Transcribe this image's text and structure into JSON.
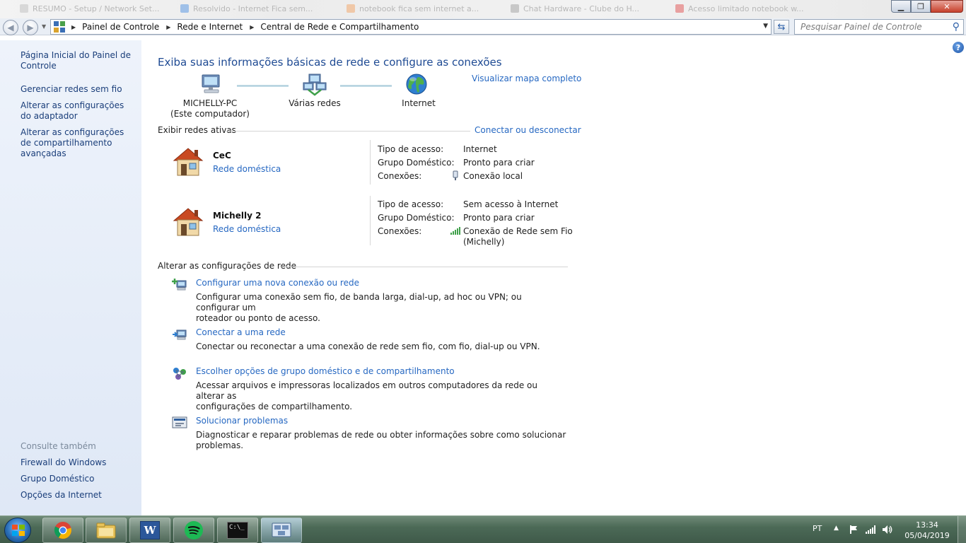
{
  "background_tabs": [
    "RESUMO - Setup / Network Set...",
    "Resolvido - Internet Fica sem...",
    "notebook fica sem internet a...",
    "Chat Hardware - Clube do H...",
    "Acesso limitado notebook w..."
  ],
  "window": {
    "minimize_label": "▁",
    "maximize_label": "❐",
    "close_label": "✕"
  },
  "address": {
    "back_icon": "back-arrow-icon",
    "forward_icon": "forward-arrow-icon",
    "breadcrumbs": [
      "Painel de Controle",
      "Rede e Internet",
      "Central de Rede e Compartilhamento"
    ],
    "search_placeholder": "Pesquisar Painel de Controle"
  },
  "sidebar": {
    "links": [
      "Página Inicial do Painel de Controle",
      "Gerenciar redes sem fio",
      "Alterar as configurações do adaptador",
      "Alterar as configurações de compartilhamento avançadas"
    ],
    "see_also_heading": "Consulte também",
    "see_also": [
      "Firewall do Windows",
      "Grupo Doméstico",
      "Opções da Internet"
    ]
  },
  "main": {
    "title": "Exiba suas informações básicas de rede e configure as conexões",
    "view_full_map": "Visualizar mapa completo",
    "map_nodes": [
      {
        "line1": "MICHELLY-PC",
        "line2": "(Este computador)"
      },
      {
        "line1": "Várias redes",
        "line2": ""
      },
      {
        "line1": "Internet",
        "line2": ""
      }
    ],
    "active_networks_label": "Exibir redes ativas",
    "connect_disconnect": "Conectar ou desconectar",
    "networks": [
      {
        "name": "CeC",
        "type": "Rede doméstica",
        "access_type_key": "Tipo de acesso:",
        "access_type_value": "Internet",
        "homegroup_key": "Grupo Doméstico:",
        "homegroup_value": "Pronto para criar",
        "connections_key": "Conexões:",
        "connection_value": "Conexão local",
        "connection_value_2": ""
      },
      {
        "name": "Michelly  2",
        "type": "Rede doméstica",
        "access_type_key": "Tipo de acesso:",
        "access_type_value": "Sem acesso à Internet",
        "homegroup_key": "Grupo Doméstico:",
        "homegroup_value": "Pronto para criar",
        "connections_key": "Conexões:",
        "connection_value": "Conexão de Rede sem Fio",
        "connection_value_2": "(Michelly)"
      }
    ],
    "change_settings_label": "Alterar as configurações de rede",
    "tasks": [
      {
        "title": "Configurar uma nova conexão ou rede",
        "desc1": "Configurar uma conexão sem fio, de banda larga, dial-up, ad hoc ou VPN; ou configurar um",
        "desc2": "roteador ou ponto de acesso."
      },
      {
        "title": "Conectar a uma rede",
        "desc1": "Conectar ou reconectar a uma conexão de rede sem fio, com fio, dial-up ou VPN.",
        "desc2": ""
      },
      {
        "title": "Escolher opções de grupo doméstico e de compartilhamento",
        "desc1": "Acessar arquivos e impressoras localizados em outros computadores da rede ou alterar as",
        "desc2": "configurações de compartilhamento."
      },
      {
        "title": "Solucionar problemas",
        "desc1": "Diagnosticar e reparar problemas de rede ou obter informações sobre como solucionar problemas.",
        "desc2": ""
      }
    ]
  },
  "taskbar": {
    "apps": [
      "chrome-icon",
      "explorer-icon",
      "word-icon",
      "spotify-icon",
      "cmd-icon",
      "network-center-icon"
    ],
    "word_label": "W",
    "cmd_label": "C:\\_",
    "language": "PT",
    "time": "13:34",
    "date": "05/04/2019"
  },
  "colors": {
    "link": "#2668c2",
    "title": "#1e4a93",
    "sidebar_link": "#1a3e7a",
    "taskbar": "#4c6a57"
  }
}
